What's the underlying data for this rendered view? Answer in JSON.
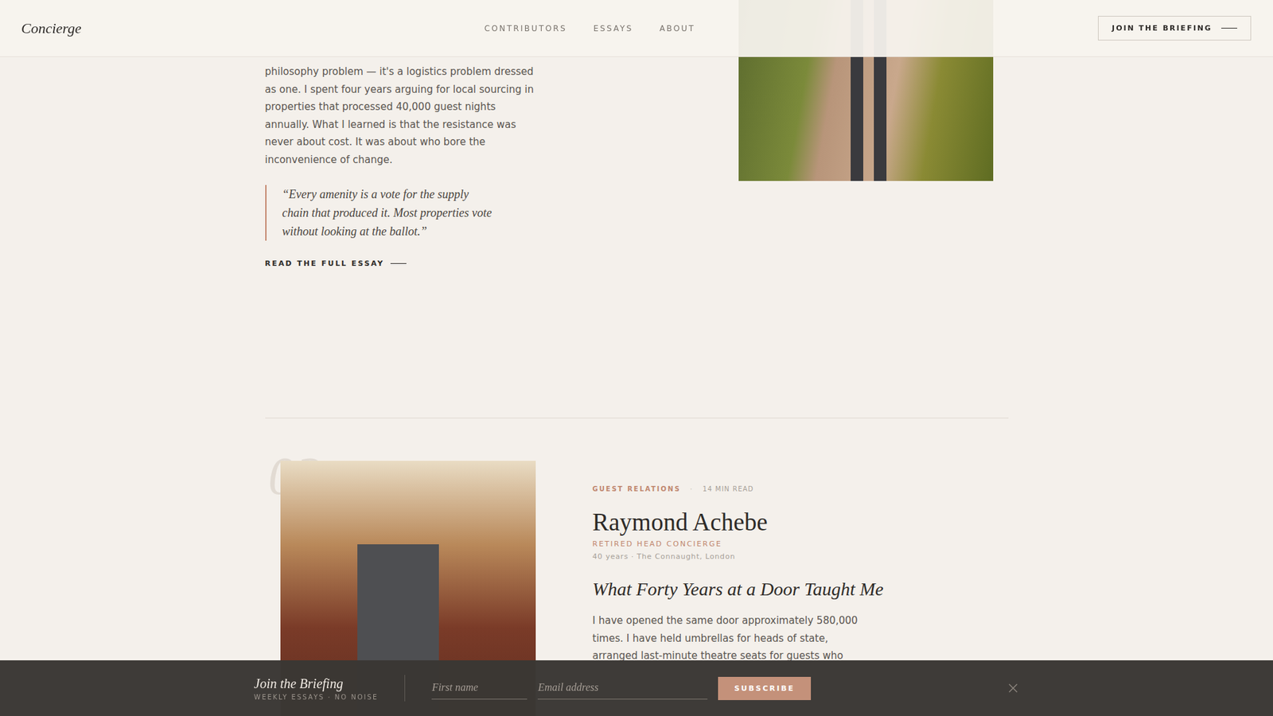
{
  "header": {
    "logo": "Concierge",
    "nav": [
      {
        "label": "CONTRIBUTORS",
        "selected": false
      },
      {
        "label": "ESSAYS",
        "selected": false
      },
      {
        "label": "ABOUT",
        "selected": false
      }
    ],
    "cta": "JOIN THE BRIEFING"
  },
  "essay_top": {
    "body": "philosophy problem — it's a logistics problem dressed as one. I spent four years arguing for local sourcing in properties that processed 40,000 guest nights annually. What I learned is that the resistance was never about cost. It was about who bore the inconvenience of change.",
    "quote": "“Every amenity is a vote for the supply chain that produced it. Most properties vote without looking at the ballot.”",
    "link": "READ THE FULL ESSAY"
  },
  "essay_feature": {
    "number": "02",
    "category": "GUEST RELATIONS",
    "separator": "·",
    "read_time": "14 MIN READ",
    "name": "Raymond Achebe",
    "role": "RETIRED HEAD CONCIERGE",
    "meta": "40 years · The Connaught, London",
    "title": "What Forty Years at a Door Taught Me",
    "body": "I have opened the same door approximately 580,000 times. I have held umbrellas for heads of state, arranged last-minute theatre seats for guests who"
  },
  "briefing_bar": {
    "title": "Join the Briefing",
    "subtitle": "WEEKLY ESSAYS · NO NOISE",
    "first_name_placeholder": "First name",
    "email_placeholder": "Email address",
    "button": "SUBSCRIBE"
  }
}
